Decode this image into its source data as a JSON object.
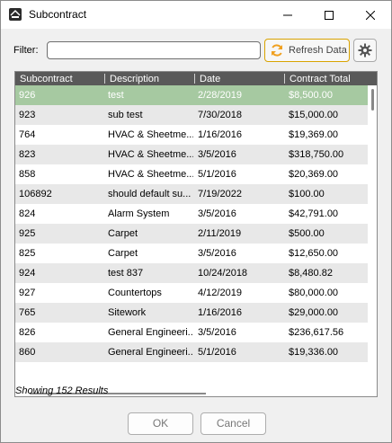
{
  "window": {
    "title": "Subcontract",
    "app_icon": "ehc-logo-icon"
  },
  "toolbar": {
    "filter_label": "Filter:",
    "filter_value": "",
    "refresh_label": "Refresh Data",
    "refresh_icon": "refresh-icon",
    "settings_icon": "gear-icon"
  },
  "grid": {
    "columns": [
      "Subcontract",
      "Description",
      "Date",
      "Contract Total"
    ],
    "rows": [
      [
        "926",
        "test",
        "2/28/2019",
        "$8,500.00"
      ],
      [
        "923",
        "sub test",
        "7/30/2018",
        "$15,000.00"
      ],
      [
        "764",
        "HVAC & Sheetme...",
        "1/16/2016",
        "$19,369.00"
      ],
      [
        "823",
        "HVAC & Sheetme...",
        "3/5/2016",
        "$318,750.00"
      ],
      [
        "858",
        "HVAC & Sheetme...",
        "5/1/2016",
        "$20,369.00"
      ],
      [
        "106892",
        "should default su...",
        "7/19/2022",
        "$100.00"
      ],
      [
        "824",
        "Alarm System",
        "3/5/2016",
        "$42,791.00"
      ],
      [
        "925",
        "Carpet",
        "2/11/2019",
        "$500.00"
      ],
      [
        "825",
        "Carpet",
        "3/5/2016",
        "$12,650.00"
      ],
      [
        "924",
        "test 837",
        "10/24/2018",
        "$8,480.82"
      ],
      [
        "927",
        "Countertops",
        "4/12/2019",
        "$80,000.00"
      ],
      [
        "765",
        "Sitework",
        "1/16/2016",
        "$29,000.00"
      ],
      [
        "826",
        "General Engineeri...",
        "3/5/2016",
        "$236,617.56"
      ],
      [
        "860",
        "General Engineeri...",
        "5/1/2016",
        "$19,336.00"
      ]
    ],
    "selected_row": 0
  },
  "status": {
    "text": "Showing 152 Results"
  },
  "footer": {
    "ok_label": "OK",
    "cancel_label": "Cancel"
  },
  "colors": {
    "header_bg": "#595959",
    "selected_row_bg": "#a6c9a1",
    "alt_row_bg": "#e8e8e8",
    "refresh_border": "#d9a300",
    "refresh_icon": "#f0a020"
  }
}
